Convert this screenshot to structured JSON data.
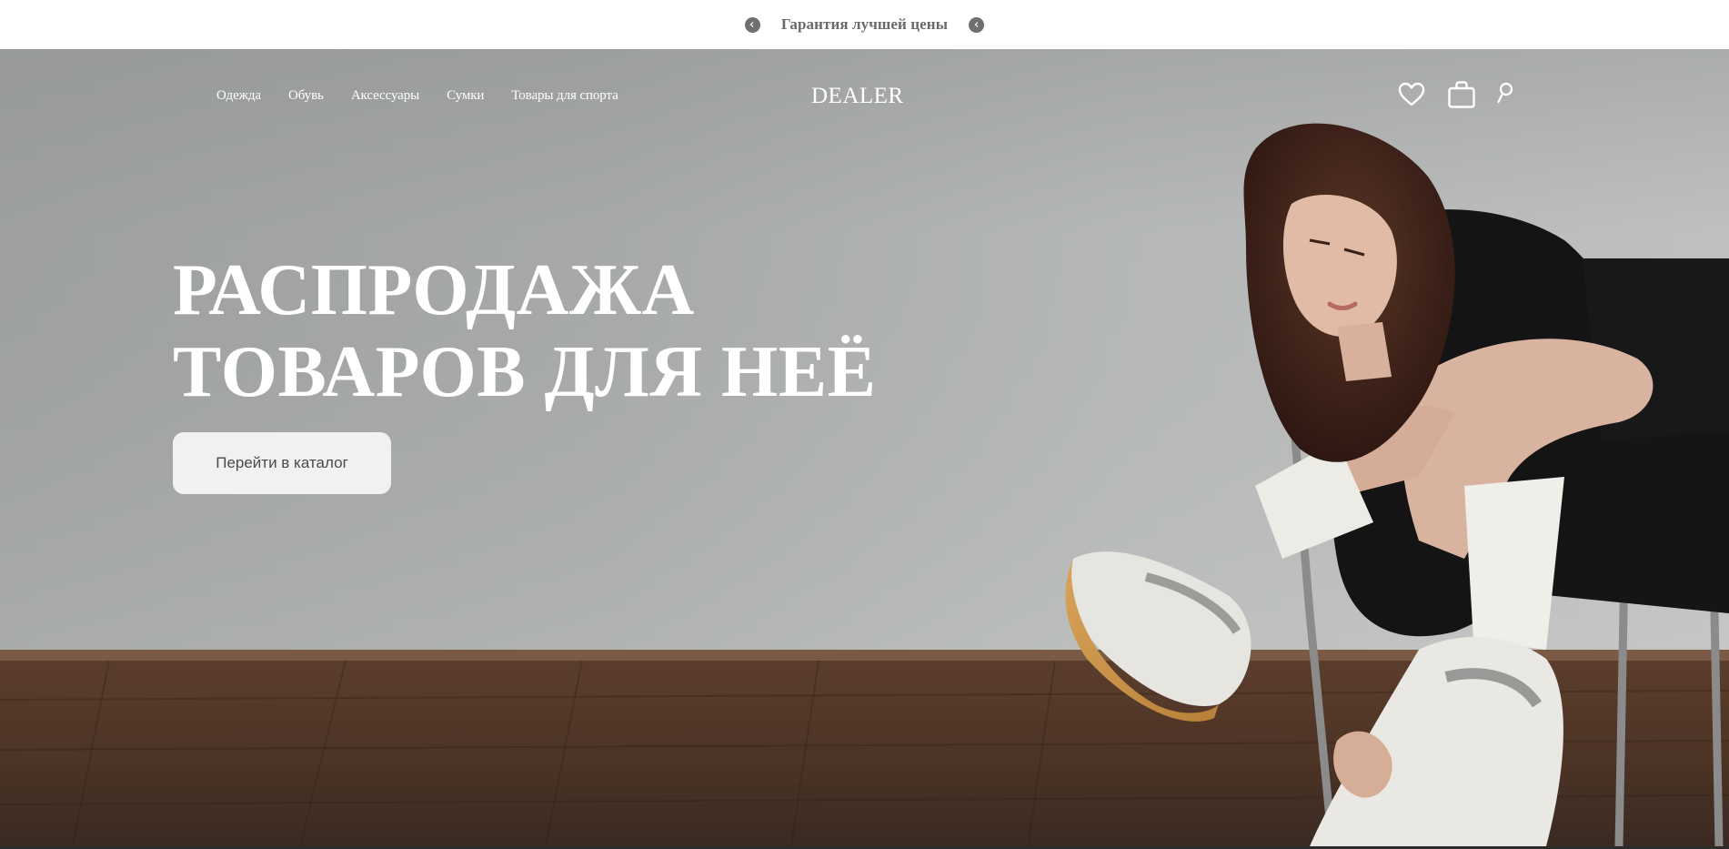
{
  "announcement": {
    "text": "Гарантия лучшей цены",
    "prev_icon": "chevron-left-icon",
    "next_icon": "chevron-left-icon"
  },
  "header": {
    "nav": [
      "Одежда",
      "Обувь",
      "Аксессуары",
      "Сумки",
      "Товары для спорта"
    ],
    "logo": "DEALER",
    "icons": [
      "heart-icon",
      "bag-icon",
      "search-icon"
    ]
  },
  "hero": {
    "title_line1": "РАСПРОДАЖА",
    "title_line2": "ТОВАРОВ ДЛЯ НЕЁ",
    "cta_label": "Перейти в каталог"
  },
  "colors": {
    "announce_text": "#6a6a6a",
    "arrow_bg": "#6f6f6f",
    "hero_text": "#ffffff",
    "cta_bg": "#f1f1f1",
    "cta_text": "#4a4a4a"
  }
}
